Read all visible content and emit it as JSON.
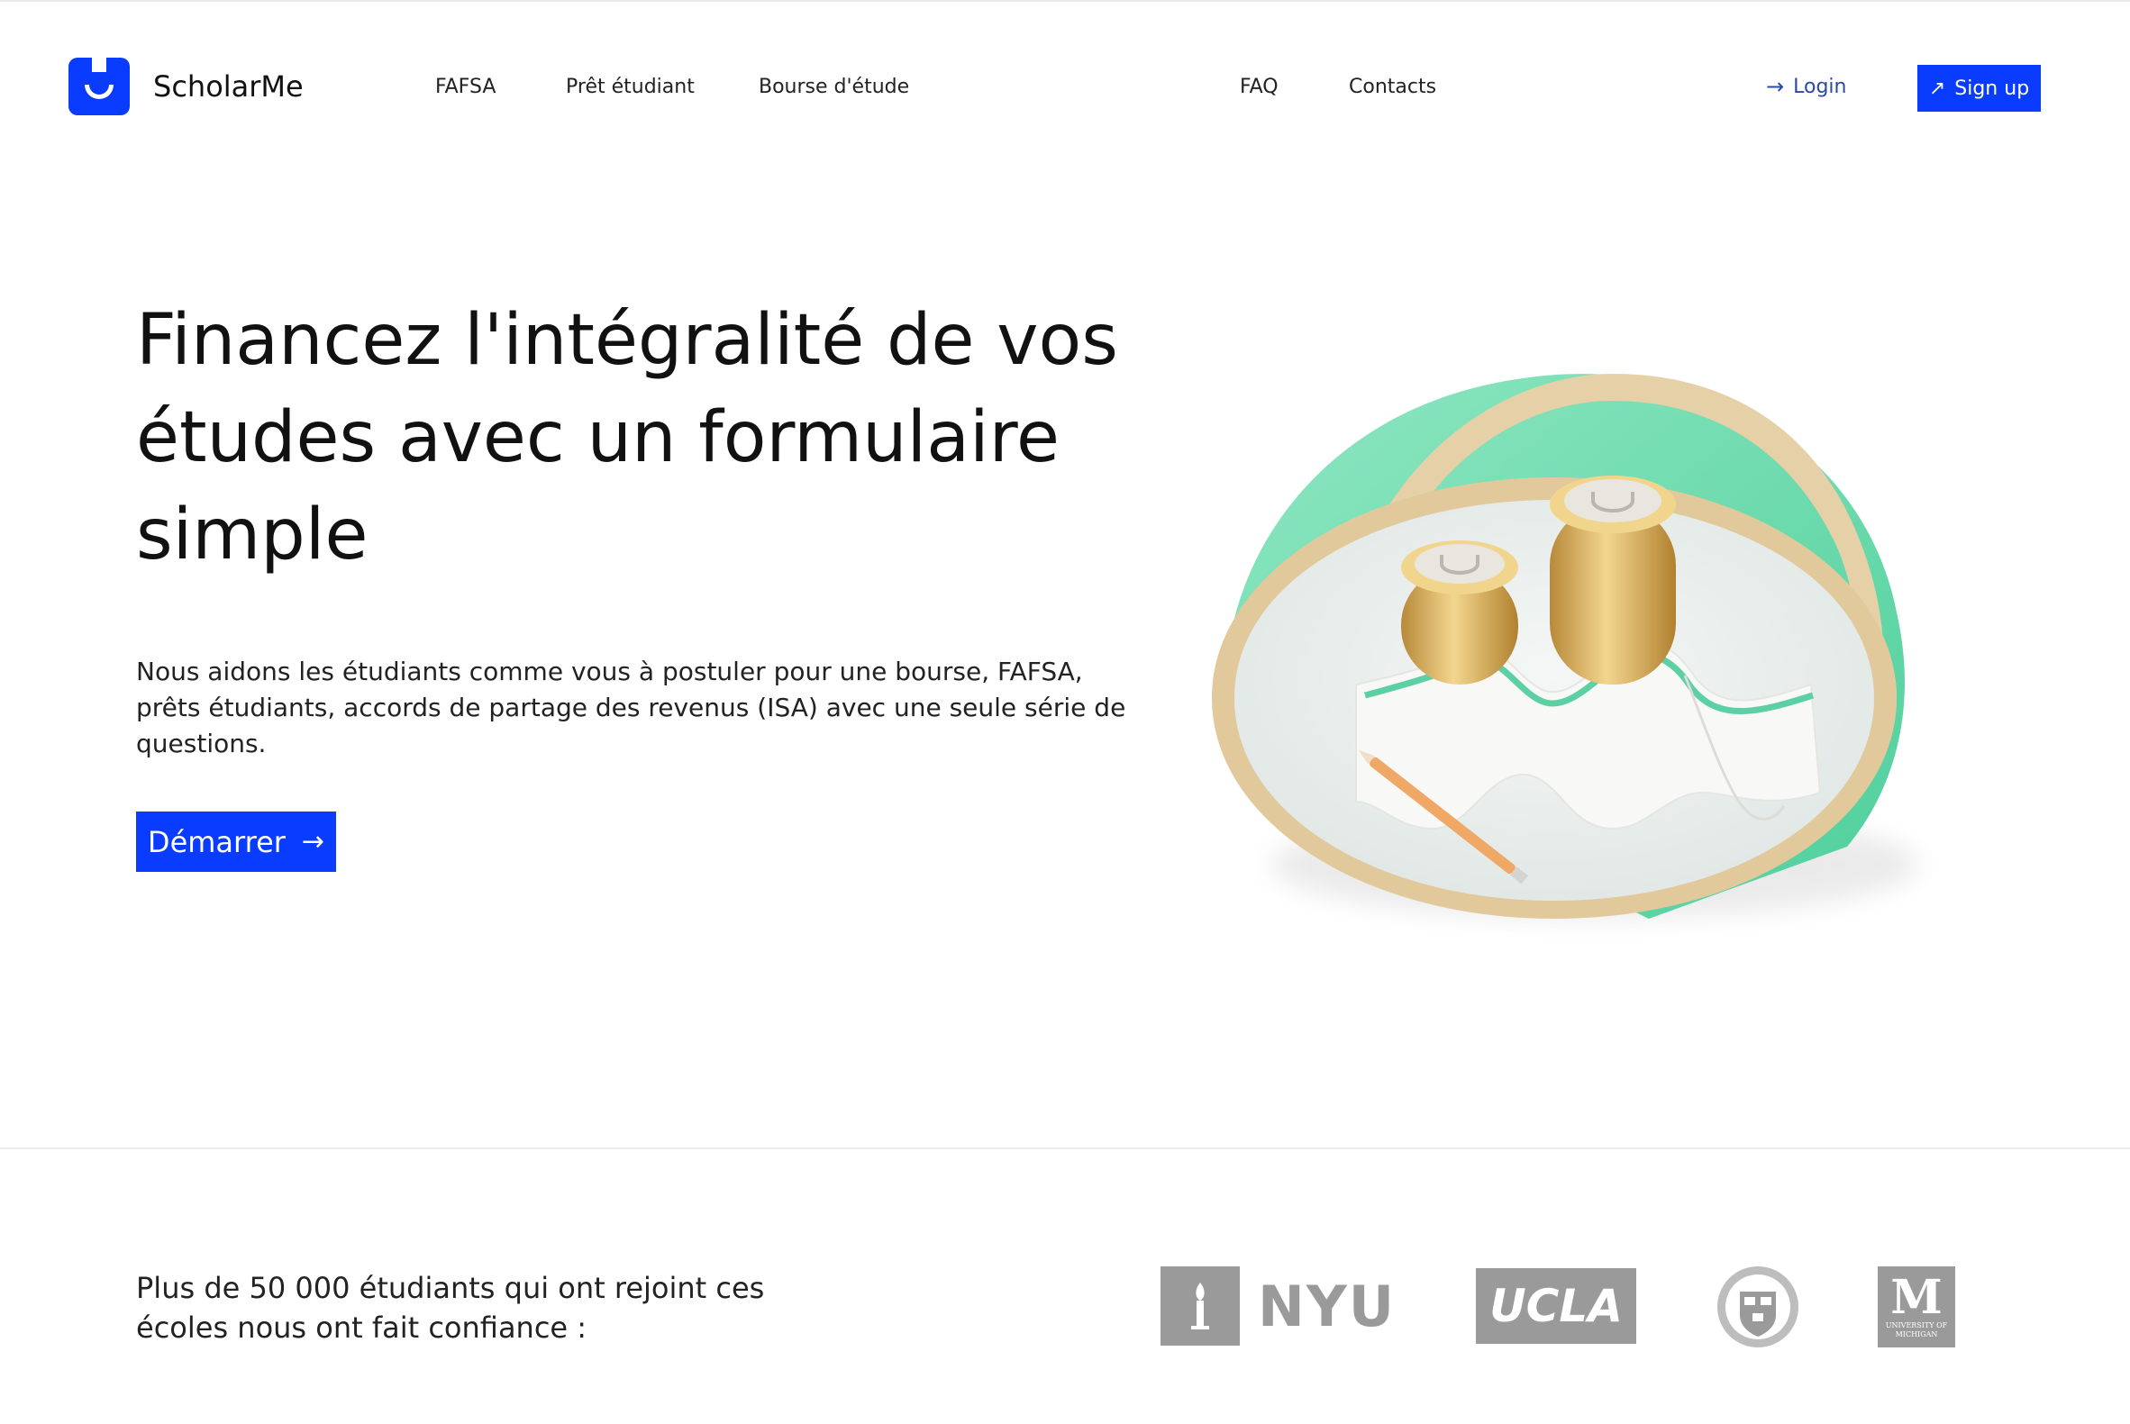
{
  "header": {
    "brand": "ScholarMe",
    "nav": [
      {
        "label": "FAFSA"
      },
      {
        "label": "Prêt étudiant"
      },
      {
        "label": "Bourse d'étude"
      },
      {
        "label": "FAQ"
      },
      {
        "label": "Contacts"
      }
    ],
    "login_label": "Login",
    "signup_label": "Sign up"
  },
  "hero": {
    "title": "Financez l'intégralité de vos études avec un formulaire simple",
    "subtitle": "Nous aidons les étudiants comme vous à postuler pour une bourse, FAFSA, prêts étudiants, accords de partage des revenus (ISA) avec une seule série de questions.",
    "cta_label": "Démarrer"
  },
  "trust": {
    "text": "Plus de 50 000 étudiants qui ont rejoint ces écoles nous ont fait confiance :",
    "schools": [
      {
        "name": "NYU"
      },
      {
        "name": "UCLA"
      },
      {
        "name": "Harvard"
      },
      {
        "name": "University of Michigan"
      }
    ],
    "michigan_letter": "M",
    "michigan_caption": "UNIVERSITY OF MICHIGAN"
  },
  "colors": {
    "brand_blue": "#0a3cff",
    "login_blue": "#2b4aa8",
    "logo_gray": "#9a9a9a",
    "mint": "#6fdcb1"
  },
  "icons": {
    "login": "arrow-right-icon",
    "signup": "arrow-up-right-icon",
    "cta": "arrow-right-icon"
  }
}
